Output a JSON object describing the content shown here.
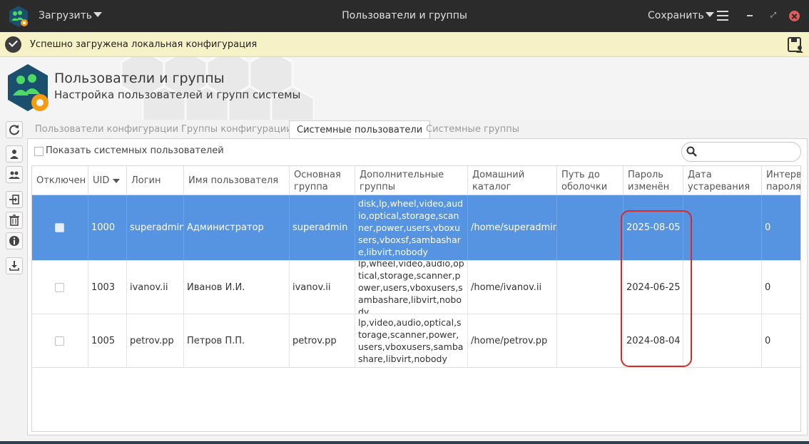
{
  "titlebar": {
    "load_label": "Загрузить",
    "title": "Пользователи и группы",
    "save_label": "Сохранить"
  },
  "notification": {
    "text": "Успешно загружена локальная конфигурация"
  },
  "header": {
    "title": "Пользователи и группы",
    "subtitle": "Настройка пользователей и групп системы"
  },
  "tabs": [
    {
      "label": "Пользователи конфигурации",
      "active": false
    },
    {
      "label": "Группы конфигурации",
      "active": false
    },
    {
      "label": "Системные пользователи",
      "active": true
    },
    {
      "label": "Системные группы",
      "active": false
    }
  ],
  "filter": {
    "show_system_label": "Показать системных пользователей",
    "search_placeholder": ""
  },
  "table": {
    "headers": [
      "Отключен",
      "UID",
      "Логин",
      "Имя пользователя",
      "Основная группа",
      "Дополнительные группы",
      "Домашний каталог",
      "Путь до оболочки",
      "Пароль изменён",
      "Дата устаревания",
      "Интервал пароля"
    ],
    "rows": [
      {
        "uid": "1000",
        "login": "superadmin",
        "name": "Администратор",
        "primary_group": "superadmin",
        "groups": "disk,lp,wheel,video,audio,optical,storage,scanner,power,users,vboxusers,vboxsf,sambashare,libvirt,nobody",
        "home": "/home/superadmin",
        "shell": "",
        "password_changed": "2025-08-05",
        "expiry": "",
        "interval": "0",
        "selected": true
      },
      {
        "uid": "1003",
        "login": "ivanov.ii",
        "name": "Иванов И.И.",
        "primary_group": "ivanov.ii",
        "groups": "lp,wheel,video,audio,optical,storage,scanner,power,users,vboxusers,sambashare,libvirt,nobody",
        "home": "/home/ivanov.ii",
        "shell": "",
        "password_changed": "2024-06-25",
        "expiry": "",
        "interval": "0",
        "selected": false
      },
      {
        "uid": "1005",
        "login": "petrov.pp",
        "name": "Петров П.П.",
        "primary_group": "petrov.pp",
        "groups": "lp,video,audio,optical,storage,scanner,power,users,vboxusers,sambashare,libvirt,nobody",
        "home": "/home/petrov.pp",
        "shell": "",
        "password_changed": "2024-08-04",
        "expiry": "",
        "interval": "0",
        "selected": false
      }
    ]
  },
  "colors": {
    "titlebar": "#2b2b2b",
    "notification": "#f7f1c7",
    "selection": "#5693e0",
    "highlight": "#d62b2b",
    "close": "#e05b5b"
  },
  "icons": {
    "toolbar": [
      "refresh-icon",
      "user-icon",
      "users-group-icon",
      "login-icon",
      "trash-icon",
      "info-icon",
      "download-icon"
    ]
  }
}
